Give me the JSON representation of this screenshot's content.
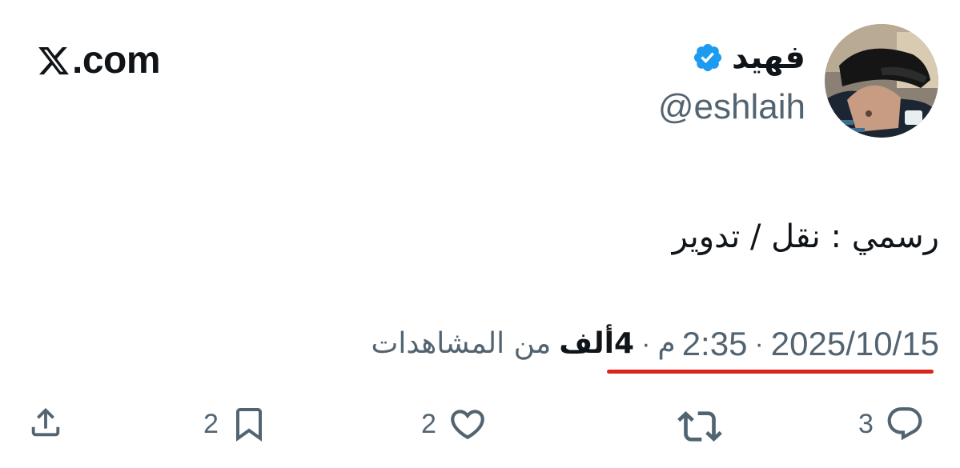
{
  "brand": {
    "site_name": ".com",
    "icon": "x-logo-icon"
  },
  "author": {
    "display_name": "فهيد",
    "handle": "@eshlaih",
    "verified_icon": "verified-badge-icon",
    "avatar_icon": "avatar"
  },
  "tweet": {
    "text": "رسمي : نقل / تدوير"
  },
  "meta": {
    "date": "2025/10/15",
    "separator": "·",
    "time": "2:35",
    "period": "م",
    "views_count": "4ألف",
    "views_label": "من المشاهدات"
  },
  "actions": {
    "reply": {
      "icon": "reply-icon",
      "count": "3"
    },
    "repost": {
      "icon": "repost-icon",
      "count": ""
    },
    "like": {
      "icon": "like-icon",
      "count": "2"
    },
    "bookmark": {
      "icon": "bookmark-icon",
      "count": "2"
    },
    "share": {
      "icon": "share-icon",
      "count": ""
    }
  },
  "colors": {
    "text_primary": "#0f1419",
    "text_secondary": "#536471",
    "verified_blue": "#1d9bf0",
    "highlight_underline": "#d9261c",
    "background": "#ffffff"
  }
}
